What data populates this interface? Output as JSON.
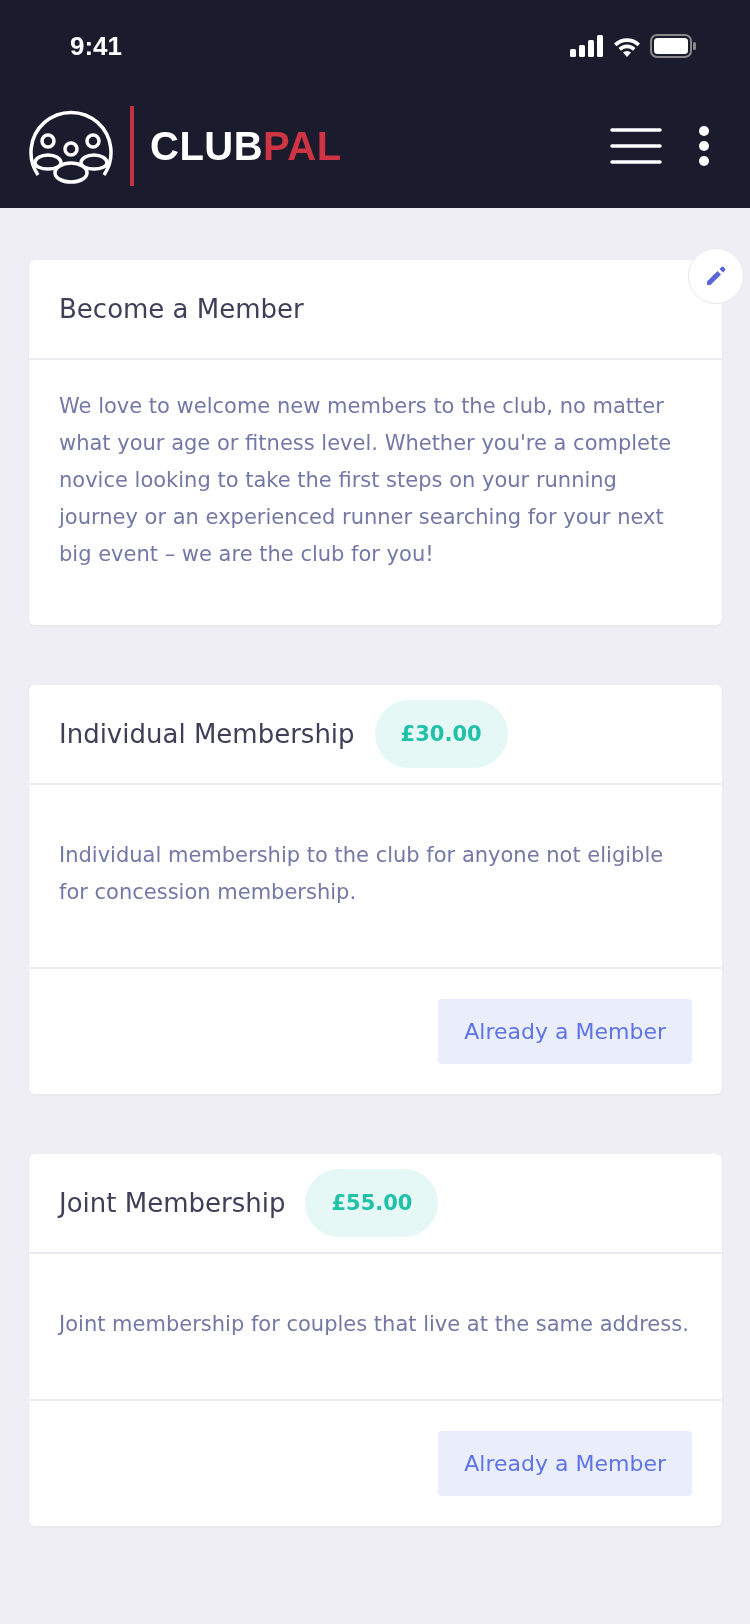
{
  "status_bar": {
    "time": "9:41"
  },
  "header": {
    "brand": {
      "first": "CLUB",
      "second": "PAL"
    }
  },
  "intro": {
    "title": "Become a Member",
    "text": "We love to welcome new members to the club, no matter what your age or fitness level. Whether you're a complete novice looking to take the first steps on your running journey or an experienced runner searching for your next big event – we are the club for you!"
  },
  "memberships": [
    {
      "title": "Individual Membership",
      "price": "£30.00",
      "description": "Individual membership to the club for anyone not eligible for concession membership.",
      "button": "Already a Member"
    },
    {
      "title": "Joint Membership",
      "price": "£55.00",
      "description": "Joint membership for couples that live at the same address.",
      "button": "Already a Member"
    }
  ]
}
